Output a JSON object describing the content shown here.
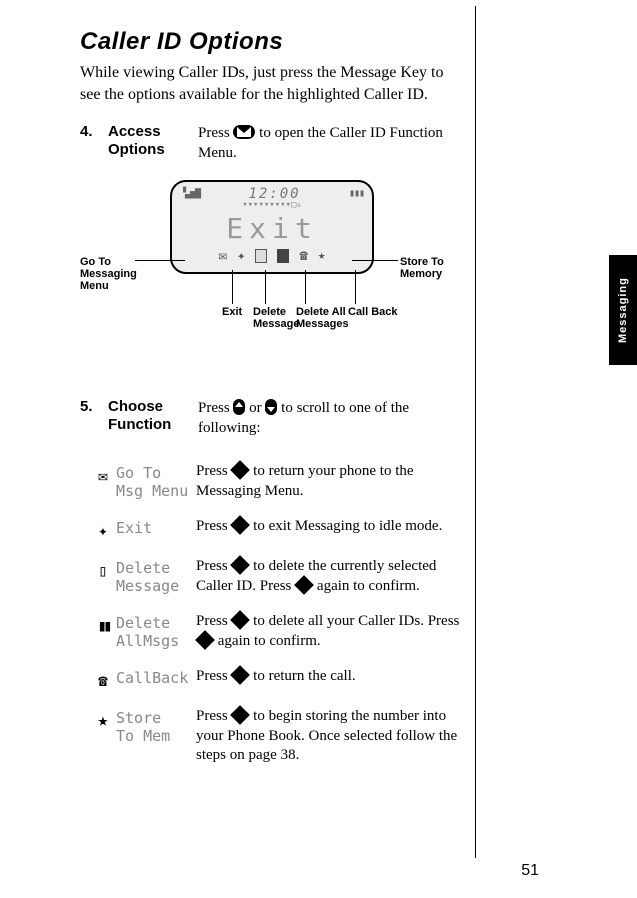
{
  "page_number": "51",
  "side_tab": "Messaging",
  "title": "Caller ID Options",
  "intro": "While viewing Caller IDs, just press the Message Key to see the options available for the highlighted Caller ID.",
  "steps": [
    {
      "num": "4.",
      "label": "Access Options",
      "desc_before": "Press ",
      "desc_after": " to open the Caller ID Function Menu."
    },
    {
      "num": "5.",
      "label": "Choose Function",
      "desc_before": "Press ",
      "desc_mid": " or ",
      "desc_after": " to scroll to one of the following:"
    }
  ],
  "lcd": {
    "time": "12:00",
    "big_text": "Exit"
  },
  "callouts": {
    "left": "Go To Messaging Menu",
    "right": "Store To Memory",
    "exit": "Exit",
    "del": "Delete Message",
    "delall": "Delete All Messages",
    "callback": "Call Back"
  },
  "functions": [
    {
      "icon_symbol": "✉",
      "label": "Go To\nMsg Menu",
      "desc_before": "Press ",
      "desc_after": " to return your phone to the Messaging Menu."
    },
    {
      "icon_symbol": "✦",
      "label": "Exit",
      "desc_before": "Press ",
      "desc_after": " to exit Messaging to idle mode."
    },
    {
      "icon_symbol": "▯",
      "label": "Delete\nMessage",
      "desc_before": "Press ",
      "desc_mid": " to delete the currently selected Caller ID. Press ",
      "desc_after": " again to confirm."
    },
    {
      "icon_symbol": "▮▮",
      "label": "Delete\nAllMsgs",
      "desc_before": "Press ",
      "desc_mid": " to delete all your Caller IDs. Press ",
      "desc_after": " again to confirm."
    },
    {
      "icon_symbol": "☎",
      "label": "CallBack",
      "desc_before": "Press ",
      "desc_after": " to return the call."
    },
    {
      "icon_symbol": "⭑",
      "label": "Store\nTo Mem",
      "desc_before": "Press ",
      "desc_after": " to begin storing the number into your Phone Book. Once selected follow the steps on page 38."
    }
  ]
}
